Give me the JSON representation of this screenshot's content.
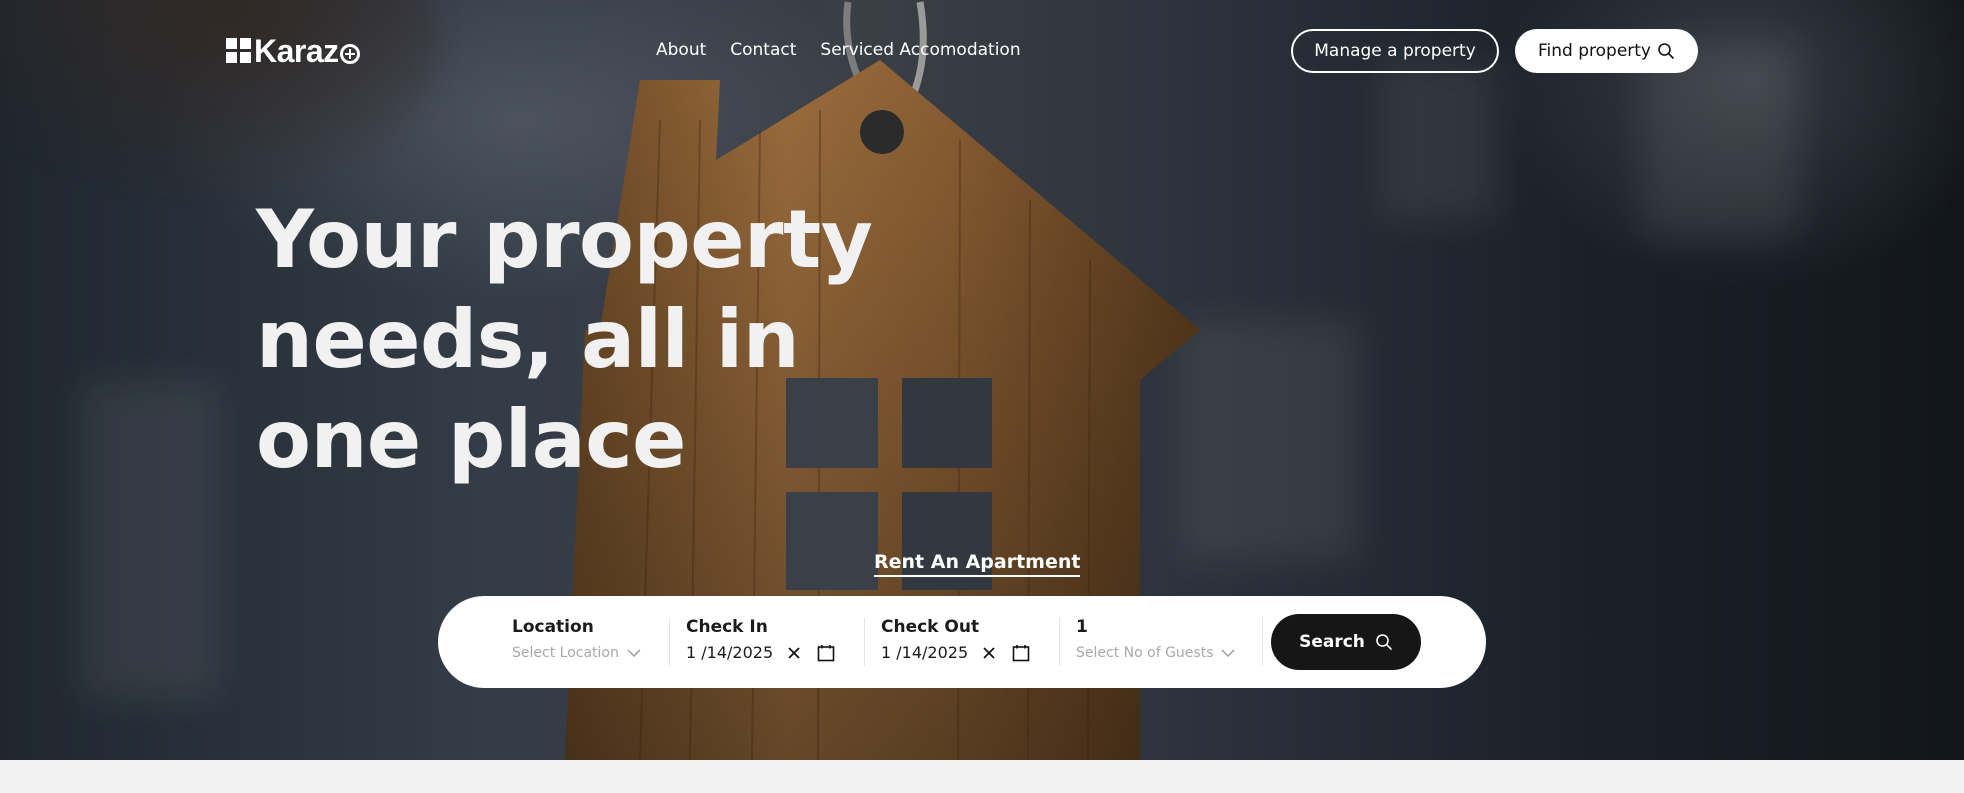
{
  "brand": {
    "name": "Karaz"
  },
  "nav": {
    "links": [
      "About",
      "Contact",
      "Serviced Accomodation"
    ],
    "manage_label": "Manage a property",
    "find_label": "Find property"
  },
  "hero": {
    "headline_lines": [
      "Your property",
      "needs, all in",
      "one place"
    ],
    "rent_link": "Rent An Apartment"
  },
  "search": {
    "location_label": "Location",
    "location_placeholder": "Select Location",
    "checkin_label": "Check In",
    "checkin_value": "1 /14/2025",
    "checkout_label": "Check Out",
    "checkout_value": "1 /14/2025",
    "guests_value": "1",
    "guests_placeholder": "Select No of Guests",
    "button_label": "Search"
  },
  "colors": {
    "dark": "#161616",
    "white": "#ffffff",
    "placeholder": "#a9a9a9"
  },
  "icons": [
    "search-icon",
    "chevron-down-icon",
    "close-icon",
    "calendar-icon"
  ]
}
